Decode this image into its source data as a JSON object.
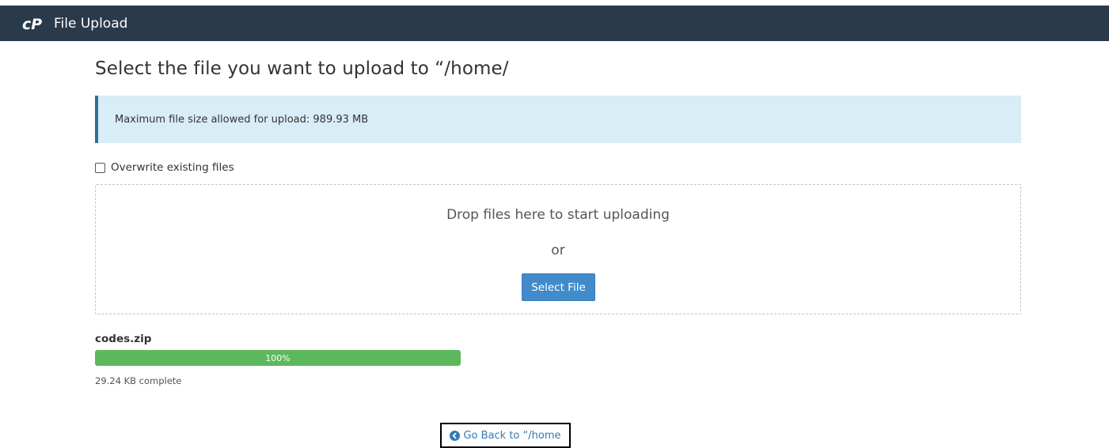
{
  "header": {
    "logo_text": "cP",
    "app_title": "File Upload"
  },
  "page": {
    "title": "Select the file you want to upload to “/home/"
  },
  "info": {
    "max_size_text": "Maximum file size allowed for upload: 989.93 MB"
  },
  "options": {
    "overwrite_label": "Overwrite existing files",
    "overwrite_checked": false
  },
  "dropzone": {
    "drop_text": "Drop files here to start uploading",
    "or_text": "or",
    "select_button_label": "Select File"
  },
  "uploads": [
    {
      "file_name": "codes.zip",
      "progress_label": "100%",
      "progress_fraction": 1.0,
      "status_text": "29.24 KB complete"
    }
  ],
  "navigation": {
    "go_back_label": "Go Back to “/home"
  },
  "colors": {
    "header_bg": "#293a4a",
    "info_bg": "#d9edf7",
    "info_border": "#31708f",
    "primary": "#428bca",
    "success": "#5cb85c",
    "link": "#337ab7"
  },
  "icons": {
    "logo": "cpanel-logo",
    "back": "arrow-circle-left-icon"
  }
}
